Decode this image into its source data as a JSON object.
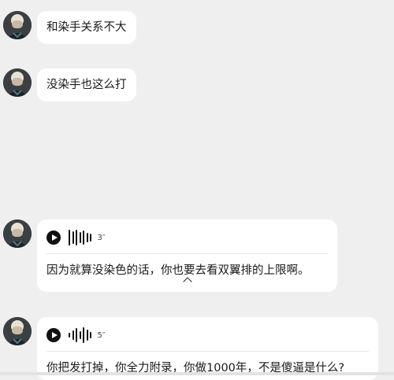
{
  "messages": [
    {
      "type": "text",
      "text": "和染手关系不大"
    },
    {
      "type": "text",
      "text": "没染手也这么打"
    },
    {
      "type": "voice",
      "duration": "3″",
      "transcript": "因为就算没染色的话，你也要去看双翼排的上限啊。"
    },
    {
      "type": "voice",
      "duration": "5″",
      "transcript": "你把发打掉，你全力附录，你做1000年，不是傻逼是什么?"
    }
  ],
  "icons": {
    "avatar": "user-avatar",
    "play": "play-icon",
    "waveform": "waveform-icon",
    "collapse": "chevron-up-icon"
  },
  "colors": {
    "background": "#efefef",
    "bubble": "#ffffff",
    "text": "#1a1a1a"
  }
}
